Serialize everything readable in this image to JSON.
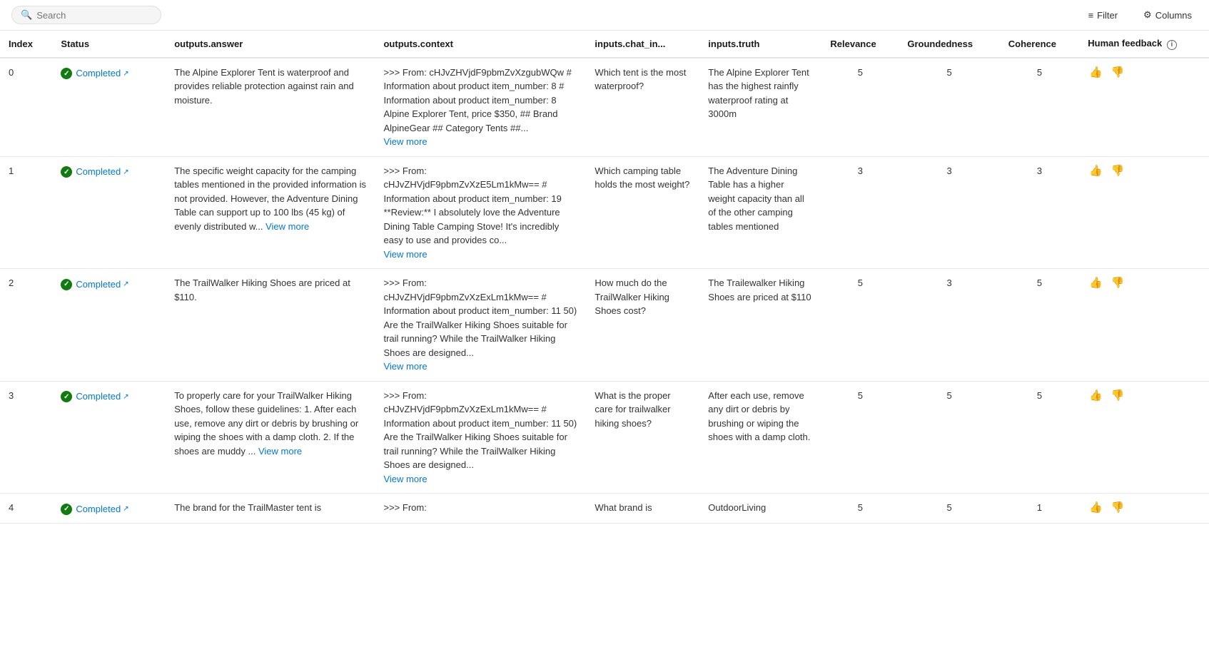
{
  "toolbar": {
    "search_placeholder": "Search",
    "filter_label": "Filter",
    "columns_label": "Columns"
  },
  "columns": [
    {
      "key": "index",
      "label": "Index"
    },
    {
      "key": "status",
      "label": "Status"
    },
    {
      "key": "answer",
      "label": "outputs.answer"
    },
    {
      "key": "context",
      "label": "outputs.context"
    },
    {
      "key": "chat_in",
      "label": "inputs.chat_in..."
    },
    {
      "key": "truth",
      "label": "inputs.truth"
    },
    {
      "key": "relevance",
      "label": "Relevance"
    },
    {
      "key": "groundedness",
      "label": "Groundedness"
    },
    {
      "key": "coherence",
      "label": "Coherence"
    },
    {
      "key": "feedback",
      "label": "Human feedback"
    }
  ],
  "rows": [
    {
      "index": "0",
      "status": "Completed",
      "answer": "The Alpine Explorer Tent is waterproof and provides reliable protection against rain and moisture.",
      "context": ">>> From: cHJvZHVjdF9pbmZvXzgubWQw # Information about product item_number: 8 # Information about product item_number: 8 Alpine Explorer Tent, price $350, ## Brand AlpineGear ## Category Tents ##...",
      "context_has_more": true,
      "chat_in": "Which tent is the most waterproof?",
      "truth": "The Alpine Explorer Tent has the highest rainfly waterproof rating at 3000m",
      "relevance": "5",
      "groundedness": "5",
      "coherence": "5"
    },
    {
      "index": "1",
      "status": "Completed",
      "answer": "The specific weight capacity for the camping tables mentioned in the provided information is not provided. However, the Adventure Dining Table can support up to 100 lbs (45 kg) of evenly distributed w...",
      "answer_has_more": true,
      "answer_more_text": "View more",
      "context": ">>> From: cHJvZHVjdF9pbmZvXzE5Lm1kMw== # Information about product item_number: 19 **Review:** I absolutely love the Adventure Dining Table Camping Stove! It's incredibly easy to use and provides co...",
      "context_has_more": true,
      "chat_in": "Which camping table holds the most weight?",
      "truth": "The Adventure Dining Table has a higher weight capacity than all of the other camping tables mentioned",
      "relevance": "3",
      "groundedness": "3",
      "coherence": "3"
    },
    {
      "index": "2",
      "status": "Completed",
      "answer": "The TrailWalker Hiking Shoes are priced at $110.",
      "context": ">>> From: cHJvZHVjdF9pbmZvXzExLm1kMw== # Information about product item_number: 11 50) Are the TrailWalker Hiking Shoes suitable for trail running? While the TrailWalker Hiking Shoes are designed...",
      "context_has_more": true,
      "chat_in": "How much do the TrailWalker Hiking Shoes cost?",
      "truth": "The Trailewalker Hiking Shoes are priced at $110",
      "relevance": "5",
      "groundedness": "3",
      "coherence": "5"
    },
    {
      "index": "3",
      "status": "Completed",
      "answer": "To properly care for your TrailWalker Hiking Shoes, follow these guidelines: 1. After each use, remove any dirt or debris by brushing or wiping the shoes with a damp cloth. 2. If the shoes are muddy ...",
      "answer_has_more": true,
      "answer_more_text": "View more",
      "context": ">>> From: cHJvZHVjdF9pbmZvXzExLm1kMw== # Information about product item_number: 11 50) Are the TrailWalker Hiking Shoes suitable for trail running? While the TrailWalker Hiking Shoes are designed...",
      "context_has_more": true,
      "chat_in": "What is the proper care for trailwalker hiking shoes?",
      "truth": "After each use, remove any dirt or debris by brushing or wiping the shoes with a damp cloth.",
      "relevance": "5",
      "groundedness": "5",
      "coherence": "5"
    },
    {
      "index": "4",
      "status": "Completed",
      "answer": "The brand for the TrailMaster tent is",
      "context": ">>> From:",
      "context_has_more": false,
      "chat_in": "What brand is",
      "truth": "OutdoorLiving",
      "relevance": "5",
      "groundedness": "5",
      "coherence": "1"
    }
  ]
}
